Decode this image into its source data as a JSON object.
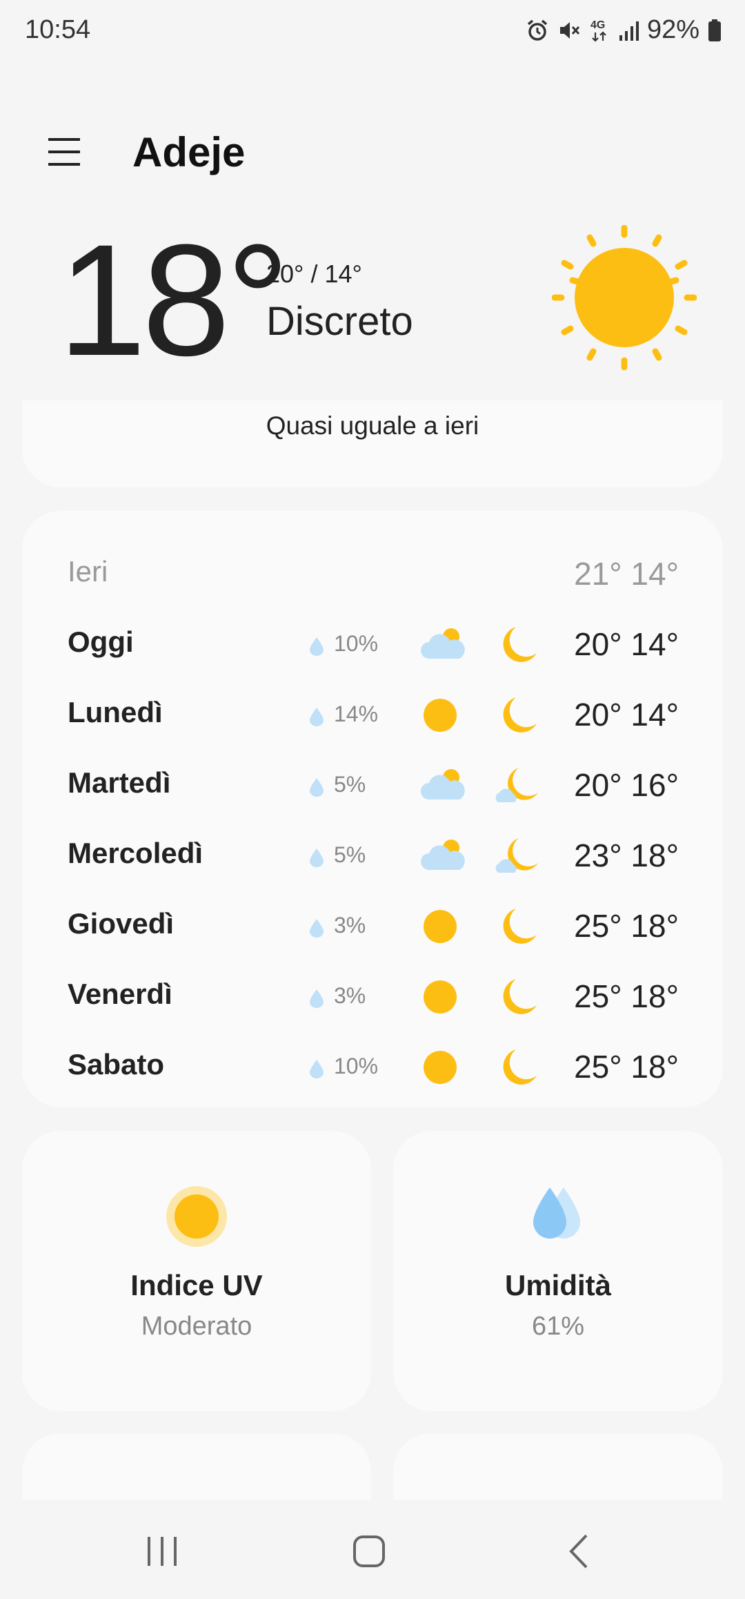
{
  "status_bar": {
    "time": "10:54",
    "network": "4G",
    "battery": "92%",
    "icons": [
      "alarm-icon",
      "mute-icon",
      "network-4g-icon",
      "signal-icon",
      "battery-icon"
    ]
  },
  "header": {
    "menu_icon": "hamburger-menu-icon",
    "city": "Adeje"
  },
  "current": {
    "temperature": "18°",
    "hi_lo": "20° / 14°",
    "condition": "Discreto",
    "icon": "sun-icon",
    "comparison": "Quasi uguale a ieri"
  },
  "forecast": {
    "yesterday": {
      "day": "Ieri",
      "temps": "21° 14°"
    },
    "days": [
      {
        "day": "Oggi",
        "precip": "10%",
        "day_icon": "partly-cloudy-icon",
        "night_icon": "moon-icon",
        "temps": "20° 14°"
      },
      {
        "day": "Lunedì",
        "precip": "14%",
        "day_icon": "sun-icon",
        "night_icon": "moon-icon",
        "temps": "20° 14°"
      },
      {
        "day": "Martedì",
        "precip": "5%",
        "day_icon": "partly-cloudy-icon",
        "night_icon": "moon-cloud-icon",
        "temps": "20° 16°"
      },
      {
        "day": "Mercoledì",
        "precip": "5%",
        "day_icon": "partly-cloudy-icon",
        "night_icon": "moon-cloud-icon",
        "temps": "23° 18°"
      },
      {
        "day": "Giovedì",
        "precip": "3%",
        "day_icon": "sun-icon",
        "night_icon": "moon-icon",
        "temps": "25° 18°"
      },
      {
        "day": "Venerdì",
        "precip": "3%",
        "day_icon": "sun-icon",
        "night_icon": "moon-icon",
        "temps": "25° 18°"
      },
      {
        "day": "Sabato",
        "precip": "10%",
        "day_icon": "sun-icon",
        "night_icon": "moon-icon",
        "temps": "25° 18°"
      }
    ]
  },
  "tiles": {
    "uv": {
      "title": "Indice UV",
      "value": "Moderato",
      "icon": "uv-sun-icon"
    },
    "humidity": {
      "title": "Umidità",
      "value": "61%",
      "icon": "humidity-drops-icon"
    }
  },
  "colors": {
    "sun": "#FDBE13",
    "cloud": "#BFE0F7",
    "drop": "#8CC8F5",
    "text": "#222222",
    "muted": "#999999",
    "card": "#FAFAFA",
    "background": "#F5F5F5"
  },
  "nav": {
    "icons": [
      "recent-apps-icon",
      "home-icon",
      "back-icon"
    ]
  }
}
